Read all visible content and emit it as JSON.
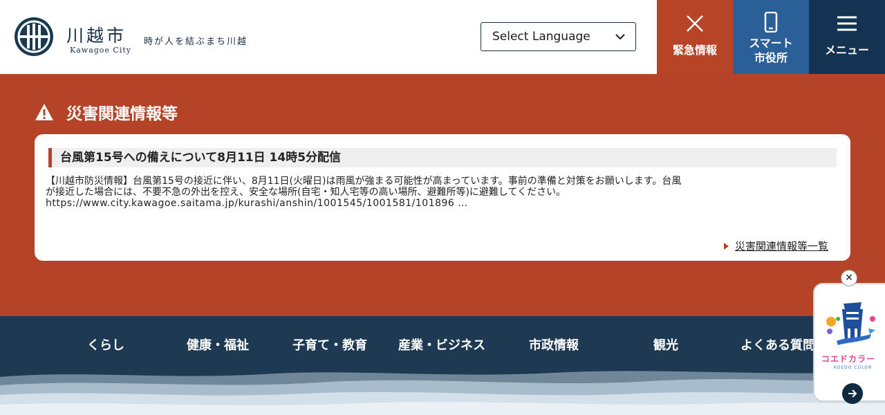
{
  "header": {
    "site_name": "川越市",
    "site_name_en": "Kawagoe City",
    "slogan": "時が人を結ぶまち川越",
    "language_select": {
      "label": "Select Language"
    },
    "buttons": {
      "emergency": "緊急情報",
      "smart_line1": "スマート",
      "smart_line2": "市役所",
      "menu": "メニュー"
    },
    "icons": {
      "emergency": "close-icon",
      "smart": "smartphone-icon",
      "menu": "hamburger-icon"
    }
  },
  "disaster": {
    "title": "災害関連情報等",
    "notice": {
      "heading": "台風第15号への備えについて8月11日 14時5分配信",
      "body_line1": "【川越市防災情報】台風第15号の接近に伴い、8月11日(火曜日)は雨風が強まる可能性が高まっています。事前の準備と対策をお願いします。台風",
      "body_line2": "が接近した場合には、不要不急の外出を控え、安全な場所(自宅・知人宅等の高い場所、避難所等)に避難してください。",
      "body_line3": "https://www.city.kawagoe.saitama.jp/kurashi/anshin/1001545/1001581/101896 …"
    },
    "more_link": "災害関連情報等一覧"
  },
  "nav": {
    "items": [
      "くらし",
      "健康・福祉",
      "子育て・教育",
      "産業・ビジネス",
      "市政情報",
      "観光",
      "よくある質問"
    ]
  },
  "widget": {
    "label": "コエドカラー",
    "sub": "KOEDO COLOR"
  },
  "colors": {
    "disaster_red": "#b54327",
    "emergency_red": "#b84428",
    "smart_blue": "#2a5f98",
    "navy": "#143352",
    "nav_navy": "#1d3a52"
  }
}
